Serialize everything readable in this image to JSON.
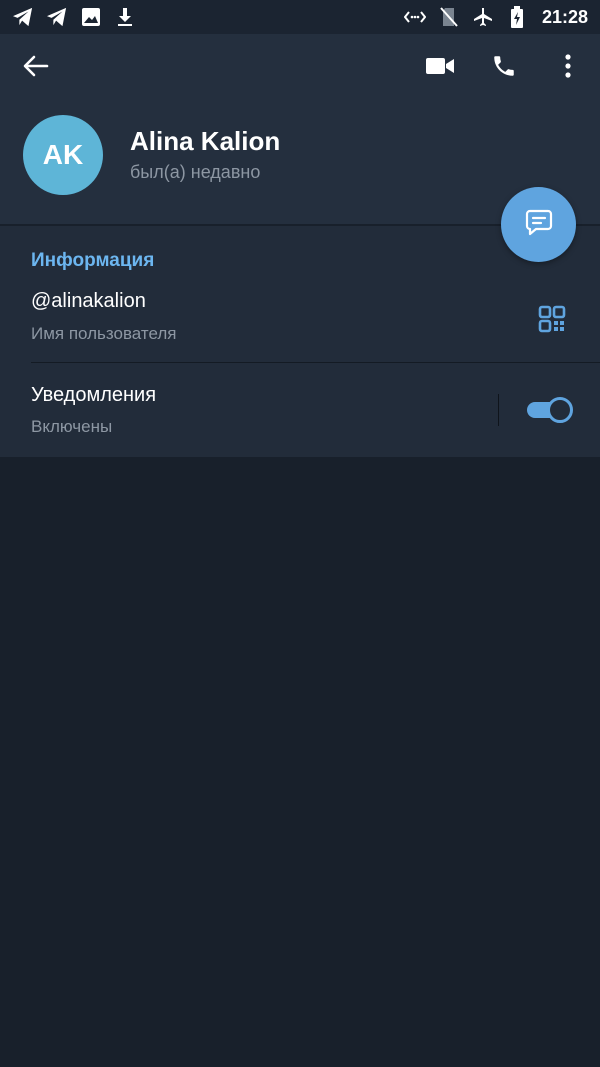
{
  "status_bar": {
    "time": "21:28",
    "left_icons": [
      "telegram-icon",
      "telegram-icon",
      "image-icon",
      "download-icon"
    ],
    "right_icons": [
      "data-transfer-icon",
      "no-sim-icon",
      "airplane-icon",
      "battery-charging-icon"
    ]
  },
  "toolbar": {
    "back_icon": "arrow-left-icon",
    "video_call_icon": "video-camera-icon",
    "call_icon": "phone-icon",
    "more_icon": "more-vertical-icon"
  },
  "profile": {
    "initials": "AK",
    "name": "Alina Kalion",
    "status": "был(а) недавно",
    "avatar_color": "#5eb5d7"
  },
  "fab": {
    "icon": "message-icon",
    "color": "#5fa4df"
  },
  "info": {
    "section_title": "Информация",
    "username": "@alinakalion",
    "username_label": "Имя пользователя",
    "qr_icon": "qr-code-icon",
    "notifications_title": "Уведомления",
    "notifications_status": "Включены",
    "notifications_enabled": true
  },
  "colors": {
    "accent": "#5fa4df",
    "section_title": "#6cb6f0",
    "background": "#18202b",
    "header": "#242f3e"
  }
}
